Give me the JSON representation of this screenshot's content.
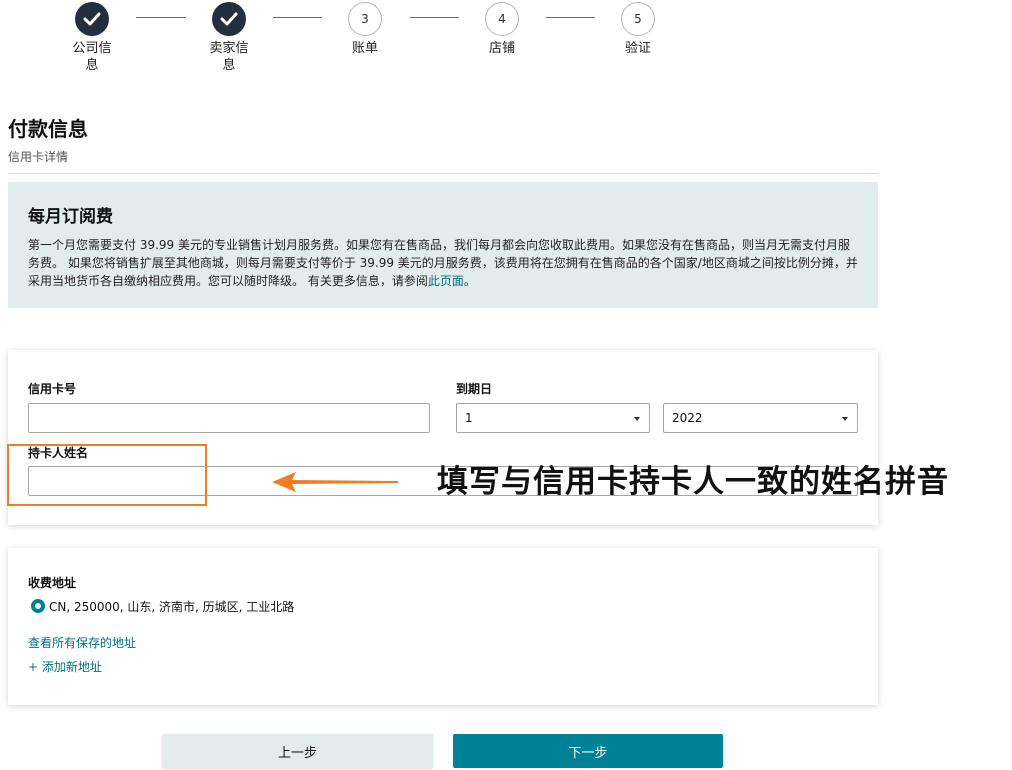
{
  "stepper": {
    "steps": [
      {
        "label": "公司信息",
        "state": "done"
      },
      {
        "label": "卖家信息",
        "state": "done"
      },
      {
        "number": "3",
        "label": "账单",
        "state": "todo"
      },
      {
        "number": "4",
        "label": "店铺",
        "state": "todo"
      },
      {
        "number": "5",
        "label": "验证",
        "state": "todo"
      }
    ]
  },
  "page": {
    "title": "付款信息",
    "subtitle": "信用卡详情"
  },
  "info": {
    "title": "每月订阅费",
    "text": "第一个月您需要支付 39.99 美元的专业销售计划月服务费。如果您有在售商品，我们每月都会向您收取此费用。如果您没有在售商品，则当月无需支付月服务费。 如果您将销售扩展至其他商城，则每月需要支付等价于 39.99 美元的月服务费，该费用将在您拥有在售商品的各个国家/地区商城之间按比例分摊，并采用当地货币各自缴纳相应费用。您可以随时降级。 有关更多信息，请参阅",
    "link": "此页面",
    "end": "。"
  },
  "card_form": {
    "card_number_label": "信用卡号",
    "card_number_value": "",
    "expiry_label": "到期日",
    "month_value": "1",
    "year_value": "2022",
    "holder_label": "持卡人姓名",
    "holder_value": ""
  },
  "address": {
    "title": "收费地址",
    "selected": "CN, 250000, 山东, 济南市, 历城区, 工业北路",
    "view_all_link": "查看所有保存的地址",
    "add_link": "+ 添加新地址"
  },
  "buttons": {
    "prev": "上一步",
    "next": "下一步"
  },
  "annotation": {
    "text": "填写与信用卡持卡人一致的姓名拼音",
    "color": "#f07d22"
  },
  "colors": {
    "accent": "#008296",
    "step_done": "#232f3e",
    "info_bg": "#e3ecec"
  }
}
